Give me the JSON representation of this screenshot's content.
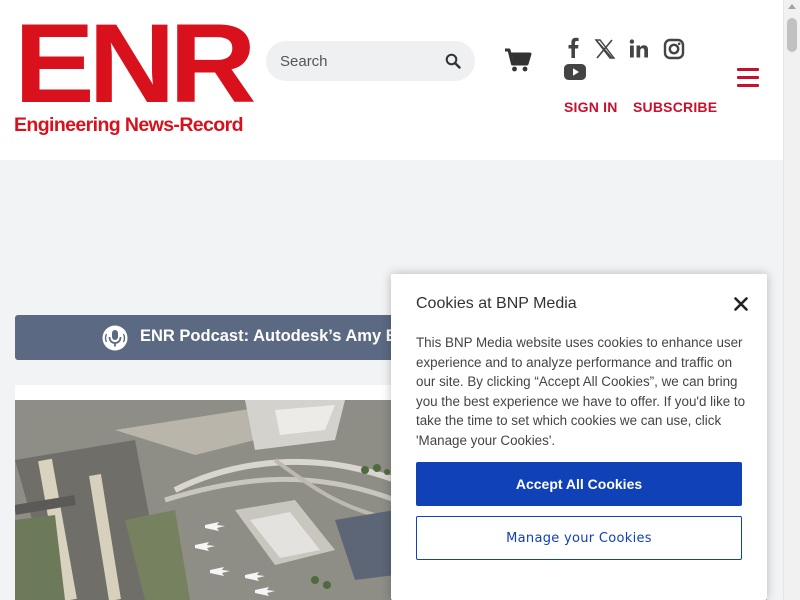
{
  "header": {
    "logo_mark": "ENR",
    "logo_subtitle": "Engineering News-Record",
    "brand_color": "#d9111c",
    "search": {
      "placeholder": "Search"
    },
    "signin_label": "SIGN IN",
    "subscribe_label": "SUBSCRIBE",
    "social": [
      "facebook-icon",
      "x-twitter-icon",
      "linkedin-icon",
      "instagram-icon",
      "youtube-icon"
    ]
  },
  "podcast": {
    "title": "ENR Podcast: Autodesk’s Amy B"
  },
  "cookie": {
    "title": "Cookies at BNP Media",
    "body": "This BNP Media website uses cookies to enhance user experience and to analyze performance and traffic on our site. By clicking “Accept All Cookies”, we can bring you the best experience we have to offer. If you'd like to take the time to set which cookies we can use, click 'Manage your Cookies'.",
    "accept_label": "Accept All Cookies",
    "manage_label": "Manage your Cookies",
    "accent_color": "#1041b6"
  }
}
